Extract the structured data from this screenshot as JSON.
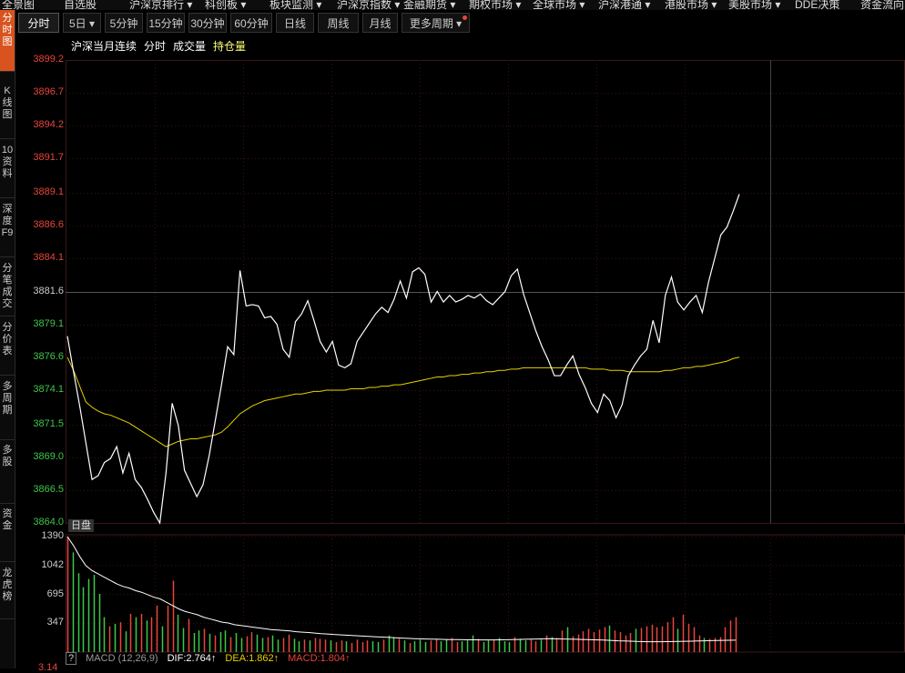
{
  "colors": {
    "up": "#e8453c",
    "down": "#3cc84a",
    "price_line": "#ffffff",
    "avg_line": "#e6d200",
    "grid": "#2b1010",
    "accent": "#d9531e"
  },
  "topnav": [
    {
      "label": "全景图"
    },
    {
      "label": "自选股"
    },
    {
      "label": "沪深京排行 ▾"
    },
    {
      "label": "科创板 ▾"
    },
    {
      "label": "板块监测 ▾"
    },
    {
      "label": "沪深京指数 ▾"
    },
    {
      "label": "金融期货 ▾"
    },
    {
      "label": "期权市场 ▾"
    },
    {
      "label": "全球市场 ▾"
    },
    {
      "label": "沪深港通 ▾"
    },
    {
      "label": "港股市场 ▾"
    },
    {
      "label": "美股市场 ▾"
    },
    {
      "label": "DDE决策"
    },
    {
      "label": "资金流向"
    }
  ],
  "sidebar": [
    {
      "label": "分时图"
    },
    {
      "label": "K线图"
    },
    {
      "label": "10资料"
    },
    {
      "label": "深度F9"
    },
    {
      "label": "分笔成交"
    },
    {
      "label": "分价表"
    },
    {
      "label": "多周期"
    },
    {
      "label": "多股"
    },
    {
      "label": "资金"
    },
    {
      "label": "龙虎榜"
    }
  ],
  "tabs": [
    {
      "label": "分时"
    },
    {
      "label": "5日 ▾"
    },
    {
      "label": "5分钟"
    },
    {
      "label": "15分钟"
    },
    {
      "label": "30分钟"
    },
    {
      "label": "60分钟"
    },
    {
      "label": "日线"
    },
    {
      "label": "周线"
    },
    {
      "label": "月线"
    },
    {
      "label": "更多周期 ▾"
    }
  ],
  "legend": {
    "name": "沪深当月连续",
    "period": "分时",
    "volume": "成交量",
    "oi": "持仓量"
  },
  "chart_data": {
    "type": "line",
    "y_axis_labels": [
      "3899.2",
      "3896.7",
      "3894.2",
      "3891.7",
      "3889.1",
      "3886.6",
      "3884.1",
      "3881.6",
      "3879.1",
      "3876.6",
      "3874.1",
      "3871.5",
      "3869.0",
      "3866.5",
      "3864.0"
    ],
    "ylim": [
      3864.0,
      3899.2
    ],
    "prev_close": 3881.6,
    "price_series": [
      3878.2,
      3875.5,
      3872.9,
      3870.1,
      3867.3,
      3867.6,
      3868.6,
      3868.9,
      3869.8,
      3867.8,
      3869.3,
      3867.3,
      3866.7,
      3865.8,
      3864.8,
      3864.0,
      3867.8,
      3873.1,
      3871.4,
      3868.0,
      3867.0,
      3866.0,
      3866.9,
      3869.1,
      3871.8,
      3874.5,
      3877.4,
      3876.8,
      3883.2,
      3880.5,
      3880.6,
      3880.5,
      3879.6,
      3879.7,
      3879.1,
      3877.2,
      3876.6,
      3879.3,
      3879.9,
      3880.9,
      3879.4,
      3877.8,
      3877.0,
      3877.8,
      3876.0,
      3875.8,
      3876.1,
      3877.8,
      3878.5,
      3879.2,
      3879.9,
      3880.4,
      3880.0,
      3881.0,
      3882.4,
      3881.1,
      3883.1,
      3883.4,
      3882.9,
      3880.8,
      3881.6,
      3880.8,
      3881.3,
      3880.8,
      3881.0,
      3881.3,
      3881.1,
      3881.4,
      3880.9,
      3880.6,
      3881.1,
      3881.6,
      3882.8,
      3883.3,
      3881.4,
      3880.0,
      3878.6,
      3877.4,
      3876.4,
      3875.2,
      3875.2,
      3876.0,
      3876.7,
      3875.3,
      3874.3,
      3873.1,
      3872.4,
      3873.8,
      3873.3,
      3872.0,
      3873.0,
      3875.2,
      3876.0,
      3876.7,
      3877.2,
      3879.4,
      3877.7,
      3881.3,
      3882.7,
      3880.8,
      3880.2,
      3880.8,
      3881.3,
      3880.0,
      3882.3,
      3884.1,
      3885.9,
      3886.5,
      3887.7,
      3889.0
    ],
    "avg_series": [
      3876.6,
      3875.6,
      3874.4,
      3873.2,
      3872.8,
      3872.5,
      3872.3,
      3872.2,
      3872.0,
      3871.8,
      3871.6,
      3871.3,
      3871.0,
      3870.7,
      3870.4,
      3870.1,
      3869.8,
      3870.0,
      3870.2,
      3870.3,
      3870.4,
      3870.4,
      3870.5,
      3870.6,
      3870.7,
      3870.9,
      3871.3,
      3871.8,
      3872.3,
      3872.6,
      3872.9,
      3873.1,
      3873.3,
      3873.4,
      3873.5,
      3873.6,
      3873.7,
      3873.8,
      3873.8,
      3873.9,
      3874.0,
      3874.0,
      3874.1,
      3874.1,
      3874.1,
      3874.1,
      3874.2,
      3874.2,
      3874.2,
      3874.3,
      3874.3,
      3874.4,
      3874.4,
      3874.5,
      3874.5,
      3874.6,
      3874.7,
      3874.8,
      3874.9,
      3875.0,
      3875.1,
      3875.1,
      3875.2,
      3875.2,
      3875.3,
      3875.3,
      3875.4,
      3875.4,
      3875.5,
      3875.5,
      3875.6,
      3875.6,
      3875.7,
      3875.7,
      3875.8,
      3875.8,
      3875.8,
      3875.8,
      3875.8,
      3875.8,
      3875.8,
      3875.8,
      3875.8,
      3875.8,
      3875.8,
      3875.7,
      3875.7,
      3875.7,
      3875.6,
      3875.6,
      3875.6,
      3875.5,
      3875.5,
      3875.5,
      3875.5,
      3875.5,
      3875.5,
      3875.6,
      3875.6,
      3875.7,
      3875.8,
      3875.8,
      3875.9,
      3875.9,
      3876.0,
      3876.1,
      3876.2,
      3876.3,
      3876.5,
      3876.6
    ],
    "volume_labels": [
      "1390",
      "1042",
      "695",
      "347"
    ],
    "volume_ylim": [
      0,
      1390
    ],
    "volume": [
      1390,
      1200,
      950,
      780,
      880,
      930,
      700,
      420,
      310,
      340,
      360,
      250,
      460,
      420,
      460,
      380,
      420,
      560,
      310,
      560,
      860,
      450,
      290,
      400,
      230,
      260,
      280,
      220,
      200,
      240,
      260,
      180,
      230,
      170,
      190,
      240,
      210,
      170,
      180,
      200,
      150,
      170,
      210,
      160,
      130,
      150,
      140,
      170,
      160,
      150,
      140,
      120,
      140,
      130,
      110,
      150,
      120,
      140,
      130,
      120,
      150,
      200,
      180,
      160,
      140,
      110,
      130,
      150,
      120,
      140,
      160,
      130,
      150,
      170,
      120,
      130,
      140,
      200,
      160,
      120,
      140,
      150,
      170,
      130,
      120,
      180,
      160,
      140,
      150,
      130,
      150,
      200,
      180,
      170,
      260,
      300,
      190,
      210,
      250,
      280,
      240,
      270,
      300,
      320,
      260,
      240,
      200,
      230,
      280,
      290,
      310,
      330,
      300,
      310,
      360,
      420,
      280,
      450,
      340,
      300,
      200,
      170,
      160,
      170,
      180,
      300,
      380,
      420
    ],
    "volume_up": [
      1,
      0,
      0,
      0,
      0,
      0,
      0,
      0,
      1,
      0,
      1,
      0,
      1,
      0,
      1,
      0,
      1,
      1,
      0,
      1,
      1,
      0,
      0,
      1,
      0,
      0,
      1,
      0,
      1,
      0,
      0,
      1,
      0,
      0,
      1,
      1,
      0,
      0,
      1,
      0,
      0,
      1,
      1,
      0,
      0,
      1,
      0,
      1,
      1,
      1,
      0,
      1,
      1,
      0,
      1,
      1,
      1,
      1,
      0,
      0,
      1,
      0,
      0,
      1,
      0,
      1,
      0,
      0,
      0,
      1,
      1,
      0,
      0,
      1,
      1,
      0,
      0,
      0,
      1,
      0,
      0,
      1,
      0,
      0,
      0,
      1,
      0,
      0,
      1,
      1,
      0,
      1,
      0,
      1,
      1,
      0,
      1,
      1,
      1,
      1,
      1,
      1,
      1,
      0,
      1,
      1,
      1,
      1,
      0,
      1,
      1,
      1,
      1,
      1,
      1,
      1,
      0,
      1,
      1,
      1,
      1,
      0,
      1,
      1,
      1,
      1,
      1,
      1
    ],
    "volume_ma": [
      1390,
      1280,
      1150,
      1040,
      980,
      940,
      900,
      860,
      820,
      790,
      770,
      740,
      720,
      690,
      660,
      640,
      600,
      560,
      520,
      490,
      470,
      450,
      420,
      400,
      380,
      360,
      350,
      330,
      320,
      310,
      300,
      290,
      280,
      270,
      265,
      260,
      255,
      245,
      240,
      235,
      228,
      222,
      218,
      212,
      208,
      204,
      200,
      196,
      192,
      188,
      184,
      180,
      176,
      172,
      168,
      165,
      162,
      160,
      158,
      156,
      154,
      152,
      151,
      150,
      149,
      148,
      148,
      147,
      147,
      147,
      148,
      149,
      150,
      152,
      154,
      156,
      158,
      160,
      162,
      160,
      158,
      156,
      154,
      152,
      150,
      148,
      146,
      144,
      140,
      136,
      134,
      132,
      128,
      126,
      124,
      124,
      125,
      126,
      127,
      128,
      130,
      132,
      134,
      136,
      138,
      140,
      141,
      142,
      143
    ]
  },
  "session_tag": "日盘",
  "macd": {
    "help": "?",
    "name": "MACD (12,26,9)",
    "dif": "DIF:2.764↑",
    "dea": "DEA:1.862↑",
    "macd": "MACD:1.804↑",
    "partial_left": "3.14"
  }
}
